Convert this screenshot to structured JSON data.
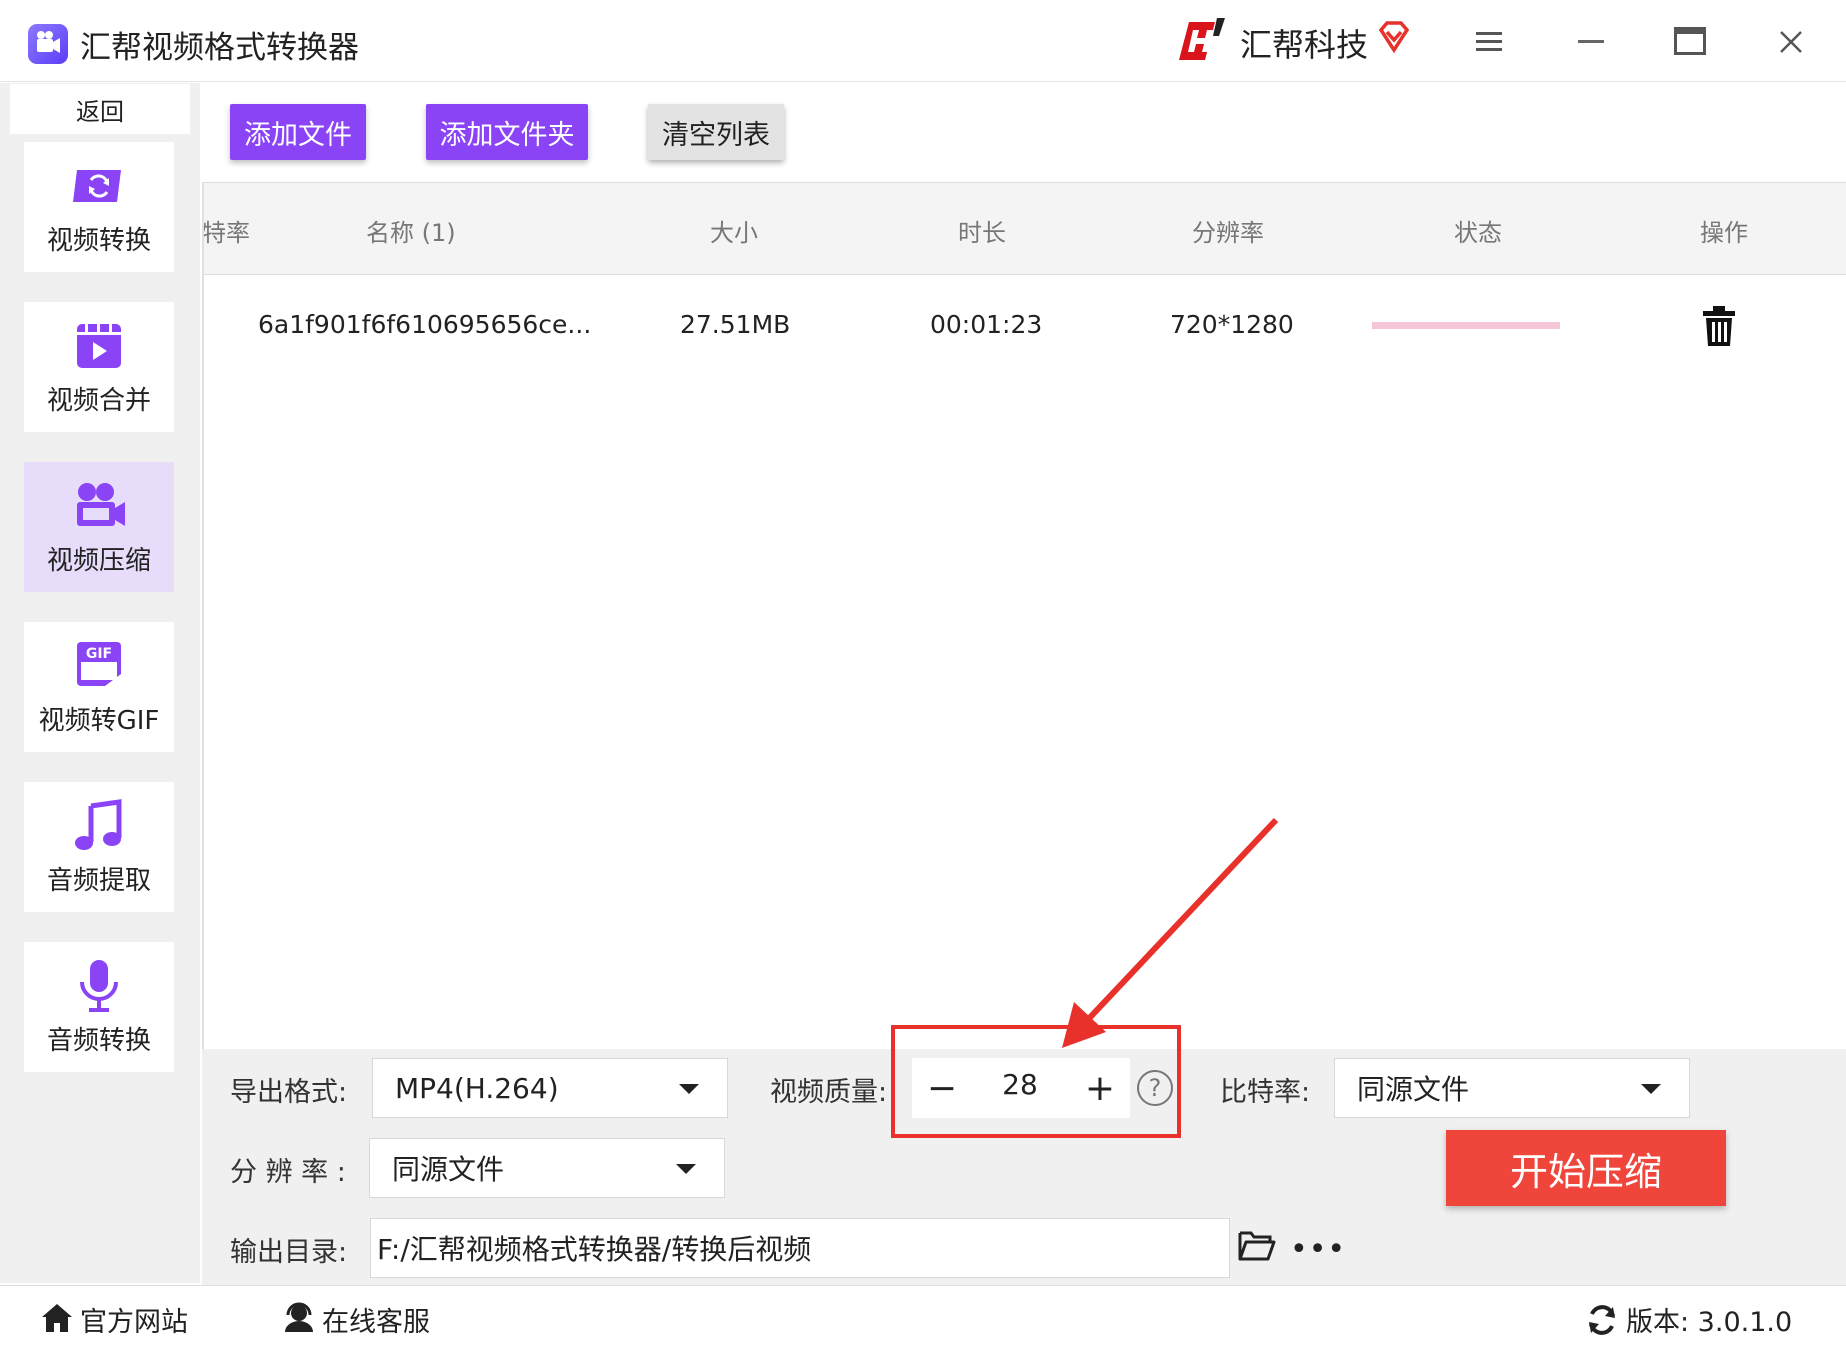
{
  "window": {
    "title": "汇帮视频格式转换器",
    "brand": "汇帮科技"
  },
  "sidebar": {
    "back_label": "返回",
    "items": [
      {
        "label": "视频转换",
        "icon": "video-convert-icon"
      },
      {
        "label": "视频合并",
        "icon": "video-merge-icon"
      },
      {
        "label": "视频压缩",
        "icon": "video-compress-icon",
        "active": true
      },
      {
        "label": "视频转GIF",
        "icon": "gif-icon"
      },
      {
        "label": "音频提取",
        "icon": "music-note-icon"
      },
      {
        "label": "音频转换",
        "icon": "microphone-icon"
      }
    ]
  },
  "toolbar": {
    "add_file": "添加文件",
    "add_folder": "添加文件夹",
    "clear_list": "清空列表"
  },
  "table": {
    "headers": [
      "特率",
      "名称 (1)",
      "大小",
      "时长",
      "分辨率",
      "状态",
      "操作"
    ],
    "rows": [
      {
        "name": "6a1f901f6f610695656ce...",
        "size": "27.51MB",
        "duration": "00:01:23",
        "resolution": "720*1280"
      }
    ]
  },
  "settings": {
    "format_label": "导出格式:",
    "format_value": "MP4(H.264)",
    "quality_label": "视频质量:",
    "quality_value": "28",
    "bitrate_label": "比特率:",
    "bitrate_value": "同源文件",
    "resolution_label": "分 辨 率 :",
    "resolution_value": "同源文件",
    "output_label": "输出目录:",
    "output_value": "F:/汇帮视频格式转换器/转换后视频",
    "start_button": "开始压缩"
  },
  "footer": {
    "website": "官方网站",
    "support": "在线客服",
    "version": "版本: 3.0.1.0"
  },
  "colors": {
    "accent_purple": "#8a44f5",
    "start_red": "#f0453b",
    "highlight_red": "#e8312b"
  }
}
